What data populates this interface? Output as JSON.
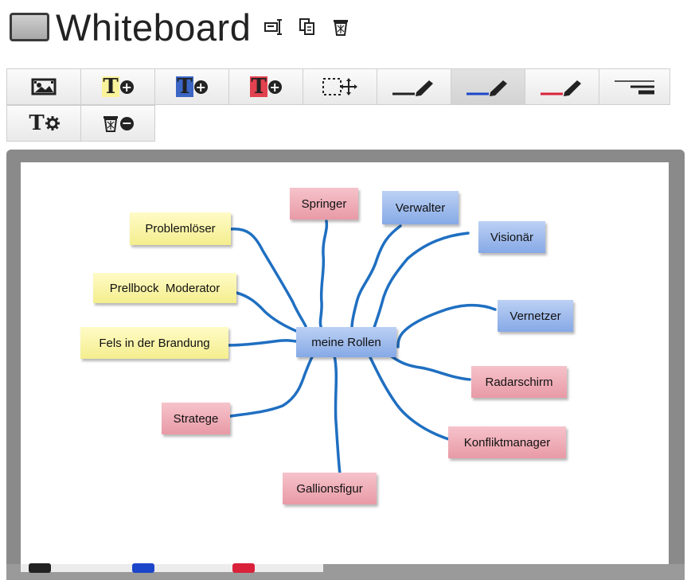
{
  "header": {
    "title": "Whiteboard"
  },
  "colors": {
    "yellow_note": "#f7f1a0",
    "red_note": "#eeaab4",
    "blue_note": "#9ab8ee",
    "connector": "#1f6fc1",
    "marker_black": "#222222",
    "marker_blue": "#1c46c9",
    "marker_red": "#d9213a"
  },
  "toolbar": {
    "row1": [
      {
        "name": "image-icon"
      },
      {
        "name": "add-yellow-note-icon"
      },
      {
        "name": "add-blue-note-icon"
      },
      {
        "name": "add-red-note-icon"
      },
      {
        "name": "select-move-icon"
      },
      {
        "name": "black-pen-icon"
      },
      {
        "name": "blue-pen-icon",
        "active": true
      },
      {
        "name": "red-pen-icon"
      },
      {
        "name": "line-width-icon"
      }
    ],
    "row2": [
      {
        "name": "text-settings-icon"
      },
      {
        "name": "delete-items-icon"
      }
    ]
  },
  "board": {
    "center_note": {
      "text": "meine Rollen",
      "color": "blue"
    },
    "notes": [
      {
        "id": "springer",
        "text": "Springer",
        "color": "red"
      },
      {
        "id": "verwalter",
        "text": "Verwalter",
        "color": "blue"
      },
      {
        "id": "visionaer",
        "text": "Visionär",
        "color": "blue"
      },
      {
        "id": "problemloeser",
        "text": "Problemlöser",
        "color": "yellow"
      },
      {
        "id": "prellbock",
        "text": "Prellbock  Moderator",
        "color": "yellow"
      },
      {
        "id": "vernetzer",
        "text": "Vernetzer",
        "color": "blue"
      },
      {
        "id": "fels",
        "text": "Fels in der Brandung",
        "color": "yellow"
      },
      {
        "id": "radarschirm",
        "text": "Radarschirm",
        "color": "red"
      },
      {
        "id": "stratege",
        "text": "Stratege",
        "color": "red"
      },
      {
        "id": "konfliktmanager",
        "text": "Konfliktmanager",
        "color": "red"
      },
      {
        "id": "gallionsfigur",
        "text": "Gallionsfigur",
        "color": "red"
      }
    ]
  },
  "markers": [
    "black",
    "blue",
    "red"
  ]
}
